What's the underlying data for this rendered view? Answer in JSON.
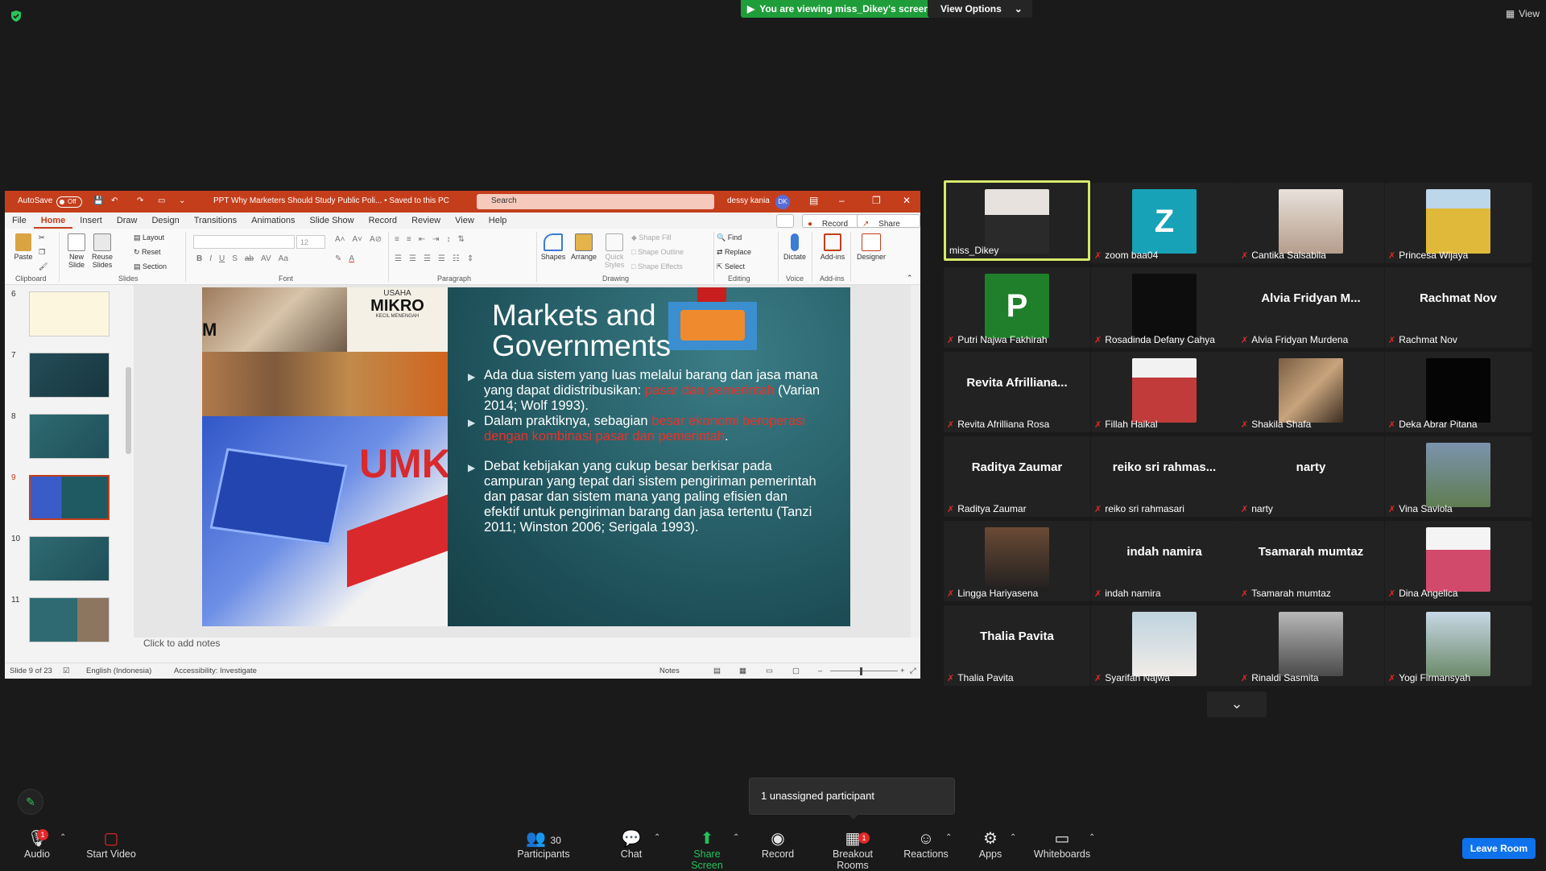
{
  "banner": {
    "viewing_text": "You are viewing miss_Dikey's screen",
    "view_options": "View Options",
    "view_label": "View"
  },
  "ppt": {
    "autosave": "AutoSave",
    "autosave_state": "Off",
    "title": "PPT Why Marketers Should Study Public Poli... • Saved to this PC",
    "search_placeholder": "Search",
    "user_name": "dessy kania",
    "user_initials": "DK",
    "tabs": [
      "File",
      "Home",
      "Insert",
      "Draw",
      "Design",
      "Transitions",
      "Animations",
      "Slide Show",
      "Record",
      "Review",
      "View",
      "Help"
    ],
    "record_btn": "Record",
    "share_btn": "Share",
    "ribbon": {
      "paste": "Paste",
      "clipboard": "Clipboard",
      "new_slide": "New Slide",
      "reuse_slides": "Reuse Slides",
      "layout": "Layout",
      "reset": "Reset",
      "section": "Section",
      "slides": "Slides",
      "font_size": "12",
      "font": "Font",
      "paragraph": "Paragraph",
      "shapes": "Shapes",
      "arrange": "Arrange",
      "quick_styles": "Quick Styles",
      "shape_fill": "Shape Fill",
      "shape_outline": "Shape Outline",
      "shape_effects": "Shape Effects",
      "drawing": "Drawing",
      "find": "Find",
      "replace": "Replace",
      "select": "Select",
      "editing": "Editing",
      "dictate": "Dictate",
      "voice": "Voice",
      "addins": "Add-ins",
      "addins_group": "Add-ins",
      "designer": "Designer"
    },
    "thumbnails": [
      "6",
      "7",
      "8",
      "9",
      "10",
      "11"
    ],
    "selected_thumb": "9",
    "slide": {
      "title": "Markets and Governments",
      "img_text_1": "USAHA",
      "img_text_2": "MIKRO",
      "img_text_3": "KECIL MENENGAH",
      "img_text_m": "M",
      "img_text_umk": "UMK",
      "b1_a": "Ada dua sistem yang luas melalui barang dan jasa mana yang dapat didistribusikan: ",
      "b1_red": "pasar dan pemerintah",
      "b1_b": " (Varian 2014; Wolf 1993).",
      "b2_a": "Dalam praktiknya, sebagian ",
      "b2_red": "besar ekonomi beroperasi dengan kombinasi pasar dan pemerintah",
      "b2_b": ".",
      "b3": "Debat kebijakan yang cukup besar berkisar pada campuran yang tepat dari sistem pengiriman pemerintah dan pasar dan sistem mana yang paling efisien dan efektif untuk pengiriman barang dan jasa tertentu (Tanzi 2011; Winston 2006; Serigala 1993)."
    },
    "notes_placeholder": "Click to add notes",
    "status": {
      "slide": "Slide 9 of 23",
      "language": "English (Indonesia)",
      "accessibility": "Accessibility: Investigate",
      "notes": "Notes"
    }
  },
  "participants": [
    {
      "name": "miss_Dikey",
      "type": "photo",
      "color": "#d8d3cf",
      "muted": false,
      "active": true
    },
    {
      "name": "zoom baa04",
      "type": "letter",
      "letter": "Z",
      "color": "#17a2b8",
      "muted": true
    },
    {
      "name": "Cantika Salsabila",
      "type": "photo",
      "color": "#c9b9ad",
      "muted": true
    },
    {
      "name": "Princesa Wijaya",
      "type": "photo",
      "color": "#e0b93a",
      "muted": true
    },
    {
      "name": "Putri Najwa Fakhirah",
      "type": "letter",
      "letter": "P",
      "color": "#1f7f2a",
      "muted": true
    },
    {
      "name": "Rosadinda Defany Cahya",
      "type": "photo",
      "color": "#0d0d0d",
      "muted": true
    },
    {
      "name": "Alvia Fridyan Murdena",
      "type": "name",
      "big": "Alvia Fridyan M...",
      "muted": true
    },
    {
      "name": "Rachmat Nov",
      "type": "name",
      "big": "Rachmat Nov",
      "muted": true
    },
    {
      "name": "Revita Afrilliana Rosa",
      "type": "name",
      "big": "Revita  Afrilliana...",
      "muted": true
    },
    {
      "name": "Fillah Haikal",
      "type": "photo",
      "color": "#c23b3b",
      "muted": true
    },
    {
      "name": "Shakila Shafa",
      "type": "photo",
      "color": "#7a5e44",
      "muted": true
    },
    {
      "name": "Deka Abrar Pitana",
      "type": "photo",
      "color": "#050505",
      "muted": true
    },
    {
      "name": "Raditya Zaumar",
      "type": "name",
      "big": "Raditya Zaumar",
      "muted": true
    },
    {
      "name": "reiko sri rahmasari",
      "type": "name",
      "big": "reiko sri rahmas...",
      "muted": true
    },
    {
      "name": "narty",
      "type": "name",
      "big": "narty",
      "muted": true
    },
    {
      "name": "Vina Saviola",
      "type": "photo",
      "color": "#5f7d52",
      "muted": true
    },
    {
      "name": "Lingga Hariyasena",
      "type": "photo",
      "color": "#6b4a35",
      "muted": true
    },
    {
      "name": "indah namira",
      "type": "name",
      "big": "indah namira",
      "muted": true
    },
    {
      "name": "Tsamarah mumtaz",
      "type": "name",
      "big": "Tsamarah mumtaz",
      "muted": true
    },
    {
      "name": "Dina Angelica",
      "type": "photo",
      "color": "#d24a6b",
      "muted": true
    },
    {
      "name": "Thalia Pavita",
      "type": "name",
      "big": "Thalia Pavita",
      "muted": true
    },
    {
      "name": "Syarifah Najwa",
      "type": "photo",
      "color": "#bfd3de",
      "muted": true
    },
    {
      "name": "Rinaldi Sasmita",
      "type": "photo",
      "color": "#4a4a4a",
      "muted": true
    },
    {
      "name": "Yogi Firmansyah",
      "type": "photo",
      "color": "#6d8b6b",
      "muted": true
    }
  ],
  "popup": {
    "unassigned": "1 unassigned participant"
  },
  "toolbar": {
    "audio": "Audio",
    "audio_badge": "1",
    "start_video": "Start Video",
    "participants": "Participants",
    "participants_count": "30",
    "chat": "Chat",
    "share_screen": "Share Screen",
    "record": "Record",
    "breakout_rooms": "Breakout Rooms",
    "breakout_badge": "1",
    "reactions": "Reactions",
    "apps": "Apps",
    "whiteboards": "Whiteboards",
    "leave": "Leave Room"
  },
  "colors": {
    "ppt_accent": "#c43e1c",
    "zoom_green": "#24c15b",
    "leave_blue": "#0e72ed",
    "muted_red": "#e02828"
  }
}
